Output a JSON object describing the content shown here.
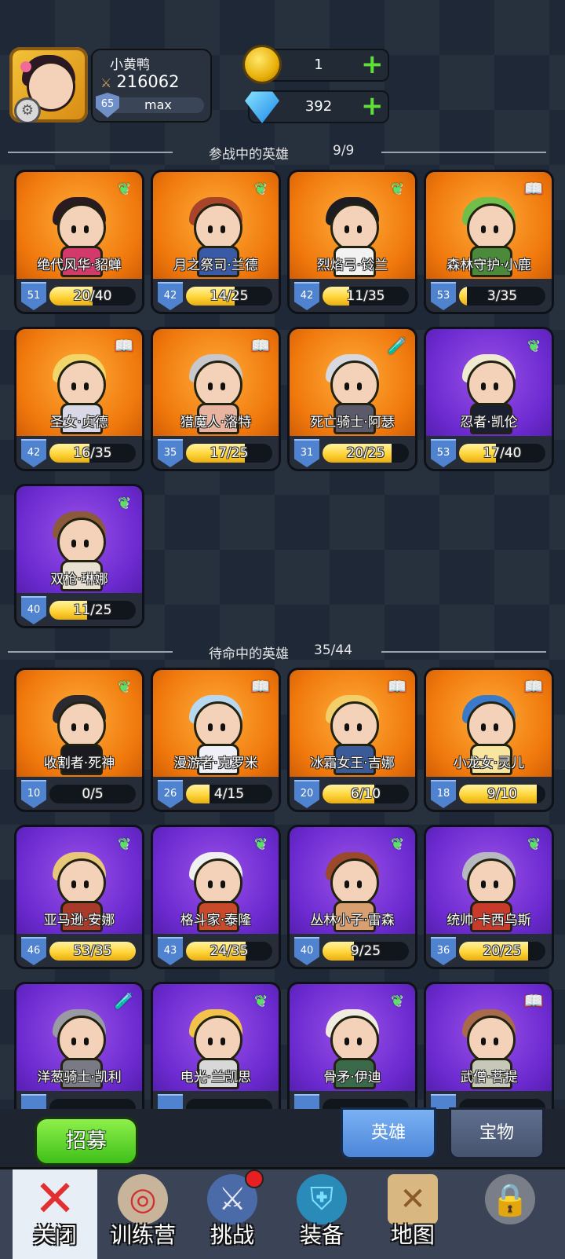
{
  "profile": {
    "name": "小黄鸭",
    "power": "216062",
    "level": "65",
    "level_text": "max"
  },
  "currency": {
    "coins": "1",
    "gems": "392"
  },
  "active_section": {
    "title": "参战中的英雄",
    "count": "9/9"
  },
  "standby_section": {
    "title": "待命中的英雄",
    "count": "35/44"
  },
  "active_heroes": [
    {
      "name": "绝代风华·貂蝉",
      "level": "51",
      "progress": "20/40",
      "fill": 0.5,
      "rarity": "orange",
      "badge": "wing-icon",
      "hair": "#2a1a22",
      "body": "#d13a6a"
    },
    {
      "name": "月之祭司·兰德",
      "level": "42",
      "progress": "14/25",
      "fill": 0.56,
      "rarity": "orange",
      "badge": "wing-icon",
      "hair": "#a8442a",
      "body": "#3a5aa8"
    },
    {
      "name": "烈焰弓·铃兰",
      "level": "42",
      "progress": "11/35",
      "fill": 0.31,
      "rarity": "orange",
      "badge": "wing-icon",
      "hair": "#1c1c22",
      "body": "#f2f2f2"
    },
    {
      "name": "森林守护·小鹿",
      "level": "53",
      "progress": "3/35",
      "fill": 0.09,
      "rarity": "orange",
      "badge": "book-icon",
      "hair": "#6fbf4a",
      "body": "#4a8a3a"
    },
    {
      "name": "圣女·贞德",
      "level": "42",
      "progress": "16/35",
      "fill": 0.46,
      "rarity": "orange",
      "badge": "book-icon",
      "hair": "#f2d66a",
      "body": "#d8d8e6"
    },
    {
      "name": "猎魔人·洛特",
      "level": "35",
      "progress": "17/25",
      "fill": 0.68,
      "rarity": "orange",
      "badge": "book-icon",
      "hair": "#c8c8cc",
      "body": "#e8b4a0"
    },
    {
      "name": "死亡骑士·阿瑟",
      "level": "31",
      "progress": "20/25",
      "fill": 0.8,
      "rarity": "orange",
      "badge": "potion-icon",
      "hair": "#d8d8e0",
      "body": "#5a5a6a"
    },
    {
      "name": "忍者·凯伦",
      "level": "53",
      "progress": "17/40",
      "fill": 0.43,
      "rarity": "purple",
      "badge": "wing-icon",
      "hair": "#f0ead0",
      "body": "#1a2030"
    },
    {
      "name": "双枪·琳娜",
      "level": "40",
      "progress": "11/25",
      "fill": 0.44,
      "rarity": "purple",
      "badge": "wing-icon",
      "hair": "#8a5a3a",
      "body": "#e8e0d0"
    }
  ],
  "standby_heroes": [
    {
      "name": "收割者·死神",
      "level": "10",
      "progress": "0/5",
      "fill": 0.0,
      "rarity": "orange",
      "badge": "wing-icon",
      "hair": "#2a2a30",
      "body": "#1a1a20"
    },
    {
      "name": "漫游者·克罗米",
      "level": "26",
      "progress": "4/15",
      "fill": 0.27,
      "rarity": "orange",
      "badge": "book-icon",
      "hair": "#b8d8f0",
      "body": "#f0f0f8"
    },
    {
      "name": "冰霜女王·吉娜",
      "level": "20",
      "progress": "6/10",
      "fill": 0.6,
      "rarity": "orange",
      "badge": "book-icon",
      "hair": "#f2cf6a",
      "body": "#3a5a98"
    },
    {
      "name": "小龙女·灵儿",
      "level": "18",
      "progress": "9/10",
      "fill": 0.9,
      "rarity": "orange",
      "badge": "book-icon",
      "hair": "#3a7ac8",
      "body": "#f8e6a0"
    },
    {
      "name": "亚马逊·安娜",
      "level": "46",
      "progress": "53/35",
      "fill": 1.0,
      "rarity": "purple",
      "badge": "wing-icon",
      "hair": "#e8c878",
      "body": "#a83a2a"
    },
    {
      "name": "格斗家·泰隆",
      "level": "43",
      "progress": "24/35",
      "fill": 0.69,
      "rarity": "purple",
      "badge": "wing-icon",
      "hair": "#f0f0f0",
      "body": "#c84a2a"
    },
    {
      "name": "丛林小子·雷森",
      "level": "40",
      "progress": "9/25",
      "fill": 0.36,
      "rarity": "purple",
      "badge": "wing-icon",
      "hair": "#9a4a2a",
      "body": "#d8a070"
    },
    {
      "name": "统帅·卡西乌斯",
      "level": "36",
      "progress": "20/25",
      "fill": 0.8,
      "rarity": "purple",
      "badge": "wing-icon",
      "hair": "#b8b8c0",
      "body": "#c83a2a"
    },
    {
      "name": "洋葱骑士·凯利",
      "level": "",
      "progress": "",
      "fill": 0.0,
      "rarity": "purple",
      "badge": "potion-icon",
      "hair": "#9a9aa2",
      "body": "#7a7a84"
    },
    {
      "name": "电光·兰凯思",
      "level": "",
      "progress": "",
      "fill": 0.0,
      "rarity": "purple",
      "badge": "wing-icon",
      "hair": "#f2c24a",
      "body": "#d8d8d8"
    },
    {
      "name": "骨矛·伊迪",
      "level": "",
      "progress": "",
      "fill": 0.0,
      "rarity": "purple",
      "badge": "wing-icon",
      "hair": "#f0ece0",
      "body": "#3a6a4a"
    },
    {
      "name": "武僧·菩提",
      "level": "",
      "progress": "",
      "fill": 0.0,
      "rarity": "purple",
      "badge": "book-icon",
      "hair": "#a86a4a",
      "body": "#c8c8b8"
    }
  ],
  "recruit_label": "招募",
  "tabs": {
    "hero": "英雄",
    "treasure": "宝物"
  },
  "nav": [
    {
      "label": "关闭",
      "icon": "close-icon"
    },
    {
      "label": "训练营",
      "icon": "target-icon"
    },
    {
      "label": "挑战",
      "icon": "sword-icon"
    },
    {
      "label": "装备",
      "icon": "armor-icon"
    },
    {
      "label": "地图",
      "icon": "map-icon"
    },
    {
      "label": "",
      "icon": "locked-icon"
    }
  ]
}
